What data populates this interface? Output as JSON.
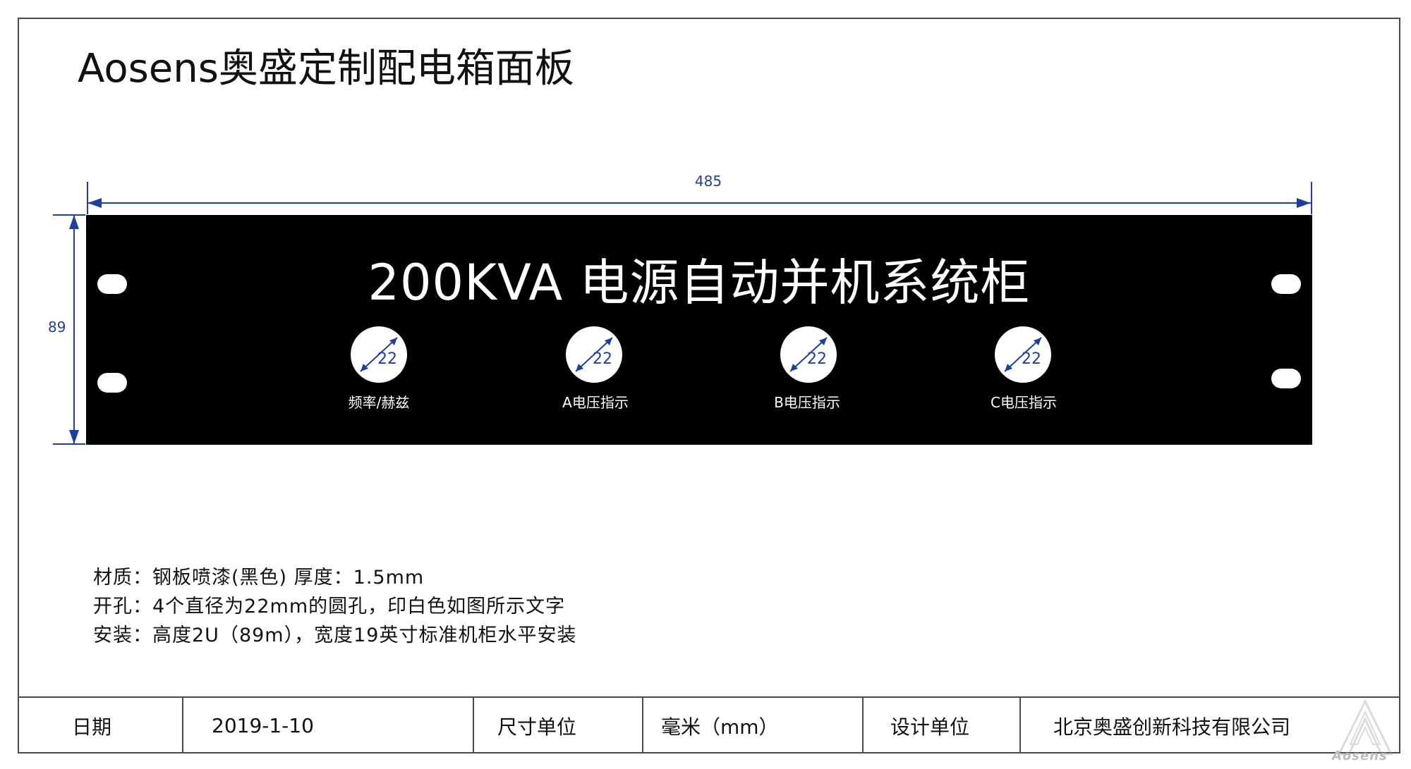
{
  "title": "Aosens奥盛定制配电箱面板",
  "dimensions": {
    "width": "485",
    "height": "89"
  },
  "panel": {
    "title": "200KVA 电源自动并机系统柜",
    "holes": [
      {
        "diameter": "22",
        "label": "频率/赫兹"
      },
      {
        "diameter": "22",
        "label": "A电压指示"
      },
      {
        "diameter": "22",
        "label": "B电压指示"
      },
      {
        "diameter": "22",
        "label": "C电压指示"
      }
    ]
  },
  "notes": [
    "材质：钢板喷漆(黑色) 厚度：1.5mm",
    "开孔：4个直径为22mm的圆孔，印白色如图所示文字",
    "安装：高度2U（89m），宽度19英寸标准机柜水平安装"
  ],
  "title_block": {
    "date_label": "日期",
    "date_value": "2019-1-10",
    "unit_label": "尺寸单位",
    "unit_value": "毫米（mm）",
    "designer_label": "设计单位",
    "designer_value": "北京奥盛创新科技有限公司"
  },
  "logo": {
    "text": "Aosens"
  },
  "colors": {
    "dimension": "#1f3f9f",
    "panel": "#000000"
  }
}
